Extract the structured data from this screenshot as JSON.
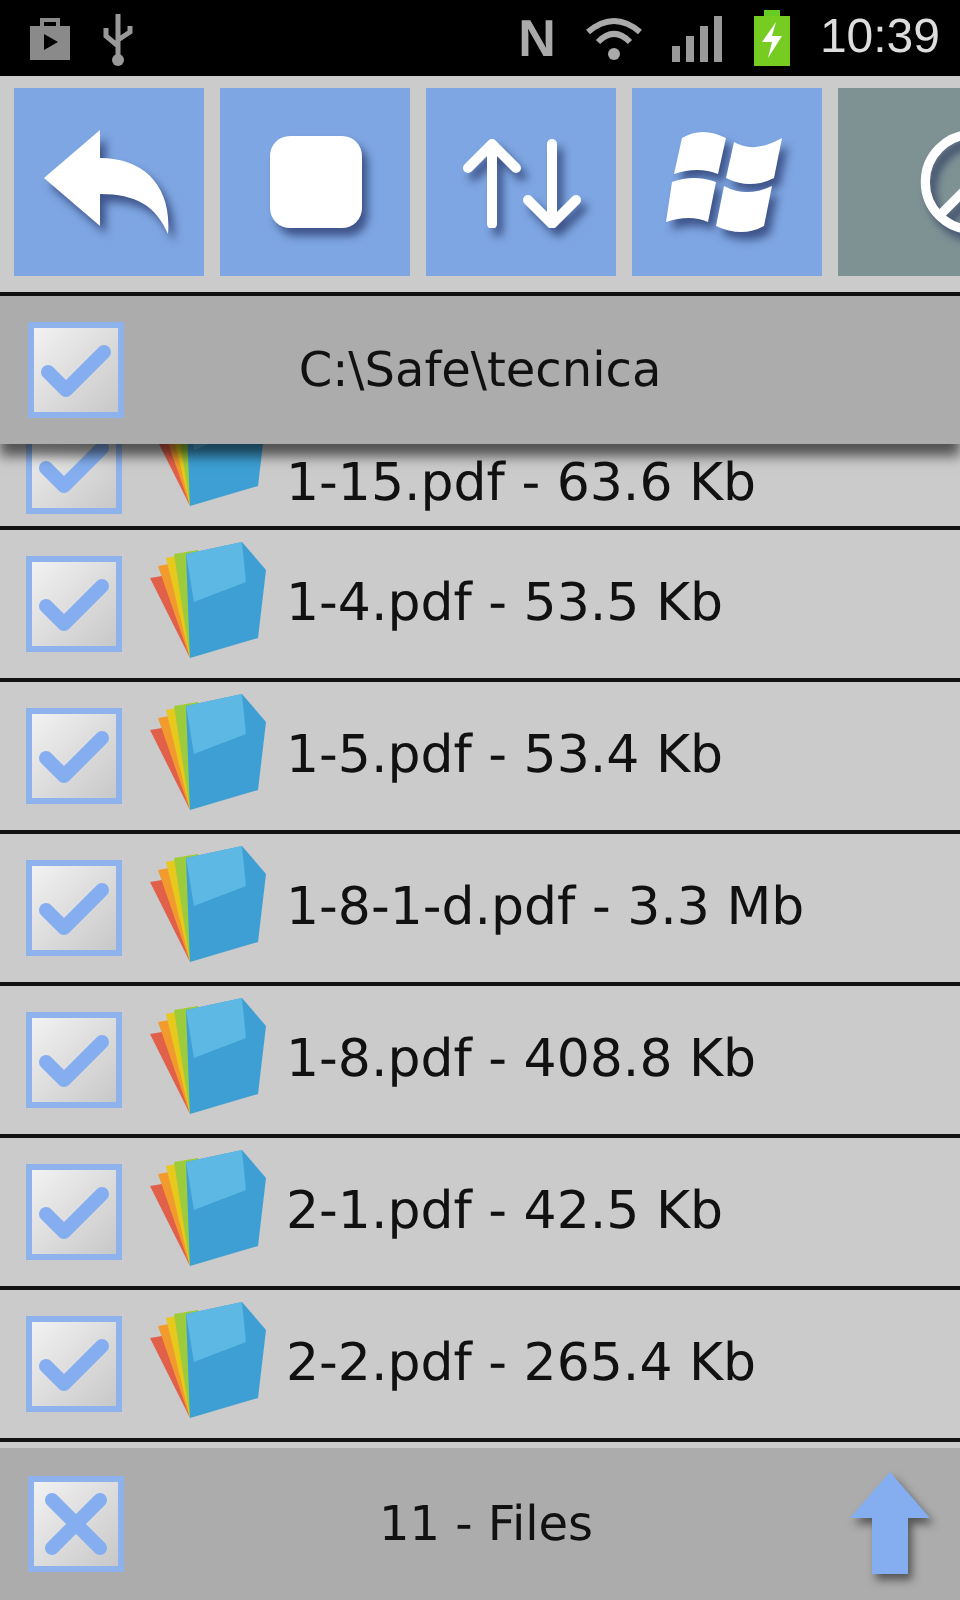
{
  "status_bar": {
    "nfc": "N",
    "time": "10:39"
  },
  "toolbar": [
    {
      "kind": "back",
      "disabled": false
    },
    {
      "kind": "stop",
      "disabled": false
    },
    {
      "kind": "sort",
      "disabled": false
    },
    {
      "kind": "windows",
      "disabled": false
    },
    {
      "kind": "cancel",
      "disabled": true
    }
  ],
  "header": {
    "path": "C:\\Safe\\tecnica",
    "checked": true
  },
  "files": [
    {
      "name": "1-15.pdf - 63.6 Kb",
      "checked": true,
      "partly_hidden": true
    },
    {
      "name": "1-4.pdf - 53.5 Kb",
      "checked": true
    },
    {
      "name": "1-5.pdf - 53.4 Kb",
      "checked": true
    },
    {
      "name": "1-8-1-d.pdf - 3.3 Mb",
      "checked": true
    },
    {
      "name": "1-8.pdf - 408.8 Kb",
      "checked": true
    },
    {
      "name": "2-1.pdf - 42.5 Kb",
      "checked": true
    },
    {
      "name": "2-2.pdf - 265.4 Kb",
      "checked": true
    }
  ],
  "footer": {
    "count": "11 - Files",
    "kind": "cross"
  }
}
